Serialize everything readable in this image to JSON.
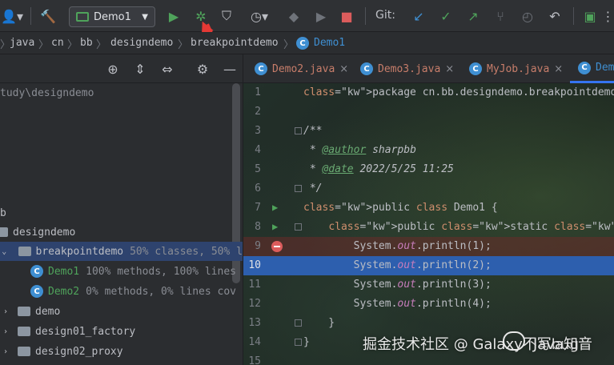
{
  "toolbar": {
    "run_config": "Demo1",
    "git_label": "Git:"
  },
  "breadcrumb": [
    "java",
    "cn",
    "bb",
    "designdemo",
    "breakpointdemo",
    "Demo1"
  ],
  "project": {
    "path_text": "tudy\\designdemo",
    "tree": [
      {
        "label": "b",
        "coverage": ""
      },
      {
        "label": "designdemo",
        "coverage": ""
      },
      {
        "label": "breakpointdemo",
        "coverage": "50% classes, 50% l"
      },
      {
        "label": "Demo1",
        "coverage": "100% methods, 100% lines"
      },
      {
        "label": "Demo2",
        "coverage": "0% methods, 0% lines cov"
      },
      {
        "label": "demo",
        "coverage": ""
      },
      {
        "label": "design01_factory",
        "coverage": ""
      },
      {
        "label": "design02_proxy",
        "coverage": ""
      }
    ]
  },
  "tabs": [
    {
      "label": "Demo2.java",
      "close": "×"
    },
    {
      "label": "Demo3.java",
      "close": "×"
    },
    {
      "label": "MyJob.java",
      "close": "×"
    },
    {
      "label": "Dem",
      "close": ""
    }
  ],
  "editor": {
    "lines": [
      {
        "n": "1",
        "text": "package cn.bb.designdemo.breakpointdemo;"
      },
      {
        "n": "2",
        "text": ""
      },
      {
        "n": "3",
        "text": "/**"
      },
      {
        "n": "4",
        "text": " * @author sharpbb"
      },
      {
        "n": "5",
        "text": " * @date 2022/5/25 11:25"
      },
      {
        "n": "6",
        "text": " */"
      },
      {
        "n": "7",
        "text": "public class Demo1 {"
      },
      {
        "n": "8",
        "text": "    public static void main(String[] args) {"
      },
      {
        "n": "9",
        "text": "        System.out.println(1);"
      },
      {
        "n": "10",
        "text": "        System.out.println(2);"
      },
      {
        "n": "11",
        "text": "        System.out.println(3);"
      },
      {
        "n": "12",
        "text": "        System.out.println(4);"
      },
      {
        "n": "13",
        "text": "    }"
      },
      {
        "n": "14",
        "text": "}"
      },
      {
        "n": "15",
        "text": ""
      }
    ]
  },
  "watermark": {
    "left": "掘金技术社区 @ Galaxy不写bug",
    "right": "Java知音"
  },
  "colors": {
    "accent": "#3574f0",
    "breakpoint": "#db5c5c",
    "run_green": "#4fa35b",
    "annotation_arrow": "#e53935"
  }
}
